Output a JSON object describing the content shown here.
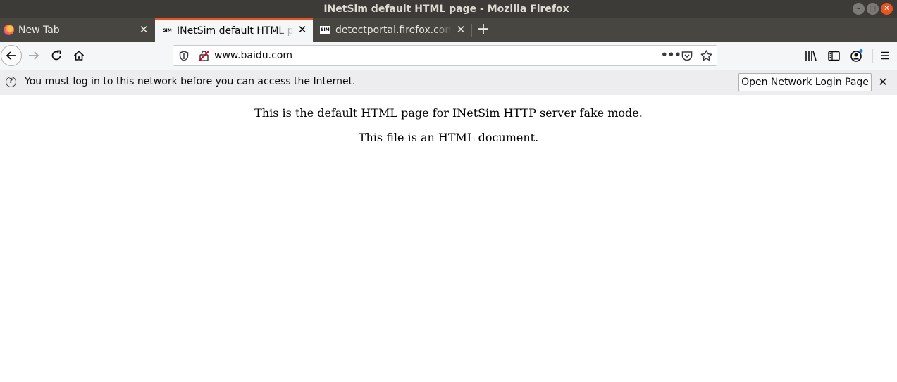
{
  "window": {
    "title": "INetSim default HTML page - Mozilla Firefox"
  },
  "tabs": [
    {
      "label": "New Tab",
      "favicon": "firefox-icon"
    },
    {
      "label": "INetSim default HTML page",
      "favicon": "sim-icon",
      "active": true
    },
    {
      "label": "detectportal.firefox.com",
      "favicon": "sim-icon"
    }
  ],
  "toolbar": {
    "url": "www.baidu.com"
  },
  "notification": {
    "message": "You must log in to this network before you can access the Internet.",
    "button_label": "Open Network Login Page"
  },
  "page": {
    "line1": "This is the default HTML page for INetSim HTTP server fake mode.",
    "line2": "This file is an HTML document."
  },
  "colors": {
    "accent": "#e95420",
    "titlebar": "#3c3b37",
    "tabstrip": "#474641"
  }
}
